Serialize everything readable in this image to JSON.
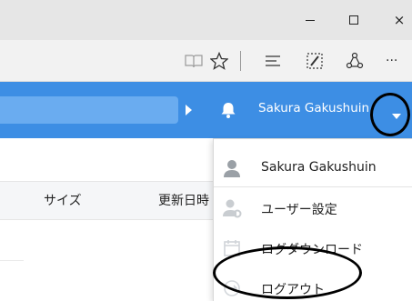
{
  "window": {
    "minimize_label": "–",
    "close_label": "×"
  },
  "toolbar": {
    "icons": [
      "reading-view-icon",
      "favorite-star-icon",
      "hub-icon",
      "web-note-icon",
      "share-icon",
      "more-icon"
    ],
    "more_label": "···"
  },
  "header": {
    "user_name": "Sakura Gakushuin",
    "accent": "#3d8ee4",
    "search_fill": "#6aacf0"
  },
  "table": {
    "columns": [
      "サイズ",
      "更新日時"
    ]
  },
  "user_menu": {
    "items": [
      {
        "label": "Sakura Gakushuin",
        "icon": "user-icon"
      },
      {
        "label": "ユーザー設定",
        "icon": "user-settings-icon"
      },
      {
        "label": "ログダウンロード",
        "icon": "calendar-icon"
      },
      {
        "label": "ログアウト",
        "icon": "logout-icon"
      }
    ]
  }
}
